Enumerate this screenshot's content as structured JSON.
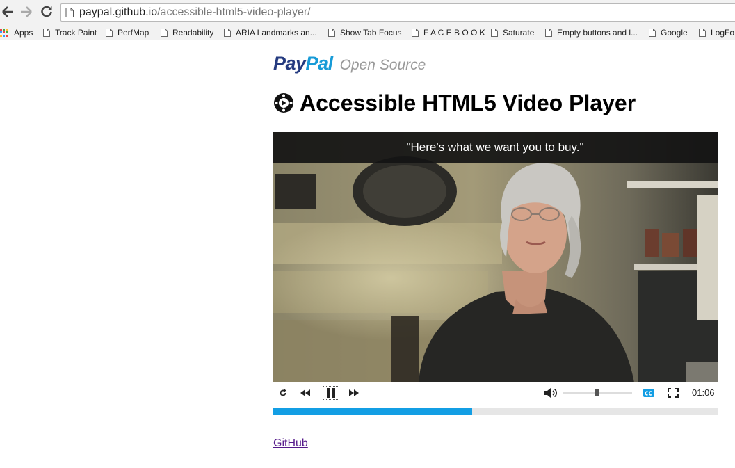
{
  "browser": {
    "url_host": "paypal.github.io",
    "url_path": "/accessible-html5-video-player/",
    "bookmarks": [
      {
        "label": "Apps",
        "icon": "apps-grid-icon"
      },
      {
        "label": "Track Paint",
        "icon": "page-icon"
      },
      {
        "label": "PerfMap",
        "icon": "page-icon"
      },
      {
        "label": "Readability",
        "icon": "page-icon"
      },
      {
        "label": "ARIA Landmarks an...",
        "icon": "page-icon"
      },
      {
        "label": "Show Tab Focus",
        "icon": "page-icon"
      },
      {
        "label": "F A C E B O O K",
        "icon": "page-icon"
      },
      {
        "label": "Saturate",
        "icon": "page-icon"
      },
      {
        "label": "Empty buttons and l...",
        "icon": "page-icon"
      },
      {
        "label": "Google",
        "icon": "page-icon"
      },
      {
        "label": "LogFo",
        "icon": "page-icon"
      }
    ]
  },
  "page": {
    "logo_pay": "Pay",
    "logo_pal": "Pal",
    "logo_subtitle": "Open Source",
    "title": "Accessible HTML5 Video Player",
    "caption": "\"Here's what we want you to buy.\"",
    "time": "01:06",
    "progress_fraction": 0.448,
    "volume_fraction": 0.5,
    "link_label": "GitHub"
  },
  "colors": {
    "paypal_dark": "#253b80",
    "paypal_light": "#179bd7",
    "progress": "#139ee4",
    "cc_button": "#139ee4"
  }
}
